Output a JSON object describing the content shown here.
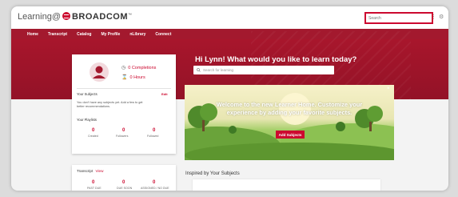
{
  "header": {
    "brand_learning": "Learning@",
    "brand_company": "BROADCOM",
    "brand_tm": "™",
    "search_placeholder": "Search"
  },
  "nav": {
    "items": [
      "Home",
      "Transcript",
      "Catalog",
      "My Profile",
      "nLibrary",
      "Connect"
    ]
  },
  "hero": {
    "greeting": "Hi Lynn! What would you like to learn today?",
    "search_placeholder": "Search for learning"
  },
  "profile": {
    "completions": "0 Completions",
    "hours": "0 Hours",
    "subjects_title": "Your Subjects",
    "edit_label": "Edit",
    "subjects_text_1": "You don't have any subjects yet. Add a few to get",
    "subjects_text_2": "better recommendations.",
    "playlists_title": "Your Playlists",
    "playlists": [
      {
        "value": "0",
        "label": "Created"
      },
      {
        "value": "0",
        "label": "Followers"
      },
      {
        "value": "0",
        "label": "Followed"
      }
    ]
  },
  "transcript": {
    "title": "Transcript",
    "view_link": "View",
    "stats": [
      {
        "value": "0",
        "label": "PAST DUE"
      },
      {
        "value": "0",
        "label": "DUE SOON"
      },
      {
        "value": "0",
        "label": "ASSIGNED / NO DUE"
      }
    ]
  },
  "welcome": {
    "line1": "Welcome to the new Learner Home. Customize your",
    "line2": "experience by adding your favorite subjects.",
    "button": "Add Subjects",
    "close": "×"
  },
  "inspired": {
    "title": "Inspired by Your Subjects"
  },
  "colors": {
    "accent": "#cc092f",
    "hero": "#a8162c",
    "nav": "#a3192e"
  },
  "icons": {
    "completions": "check-circle-icon",
    "hours": "hourglass-icon",
    "search": "search-icon",
    "help": "question-icon",
    "settings": "gear-icon"
  }
}
